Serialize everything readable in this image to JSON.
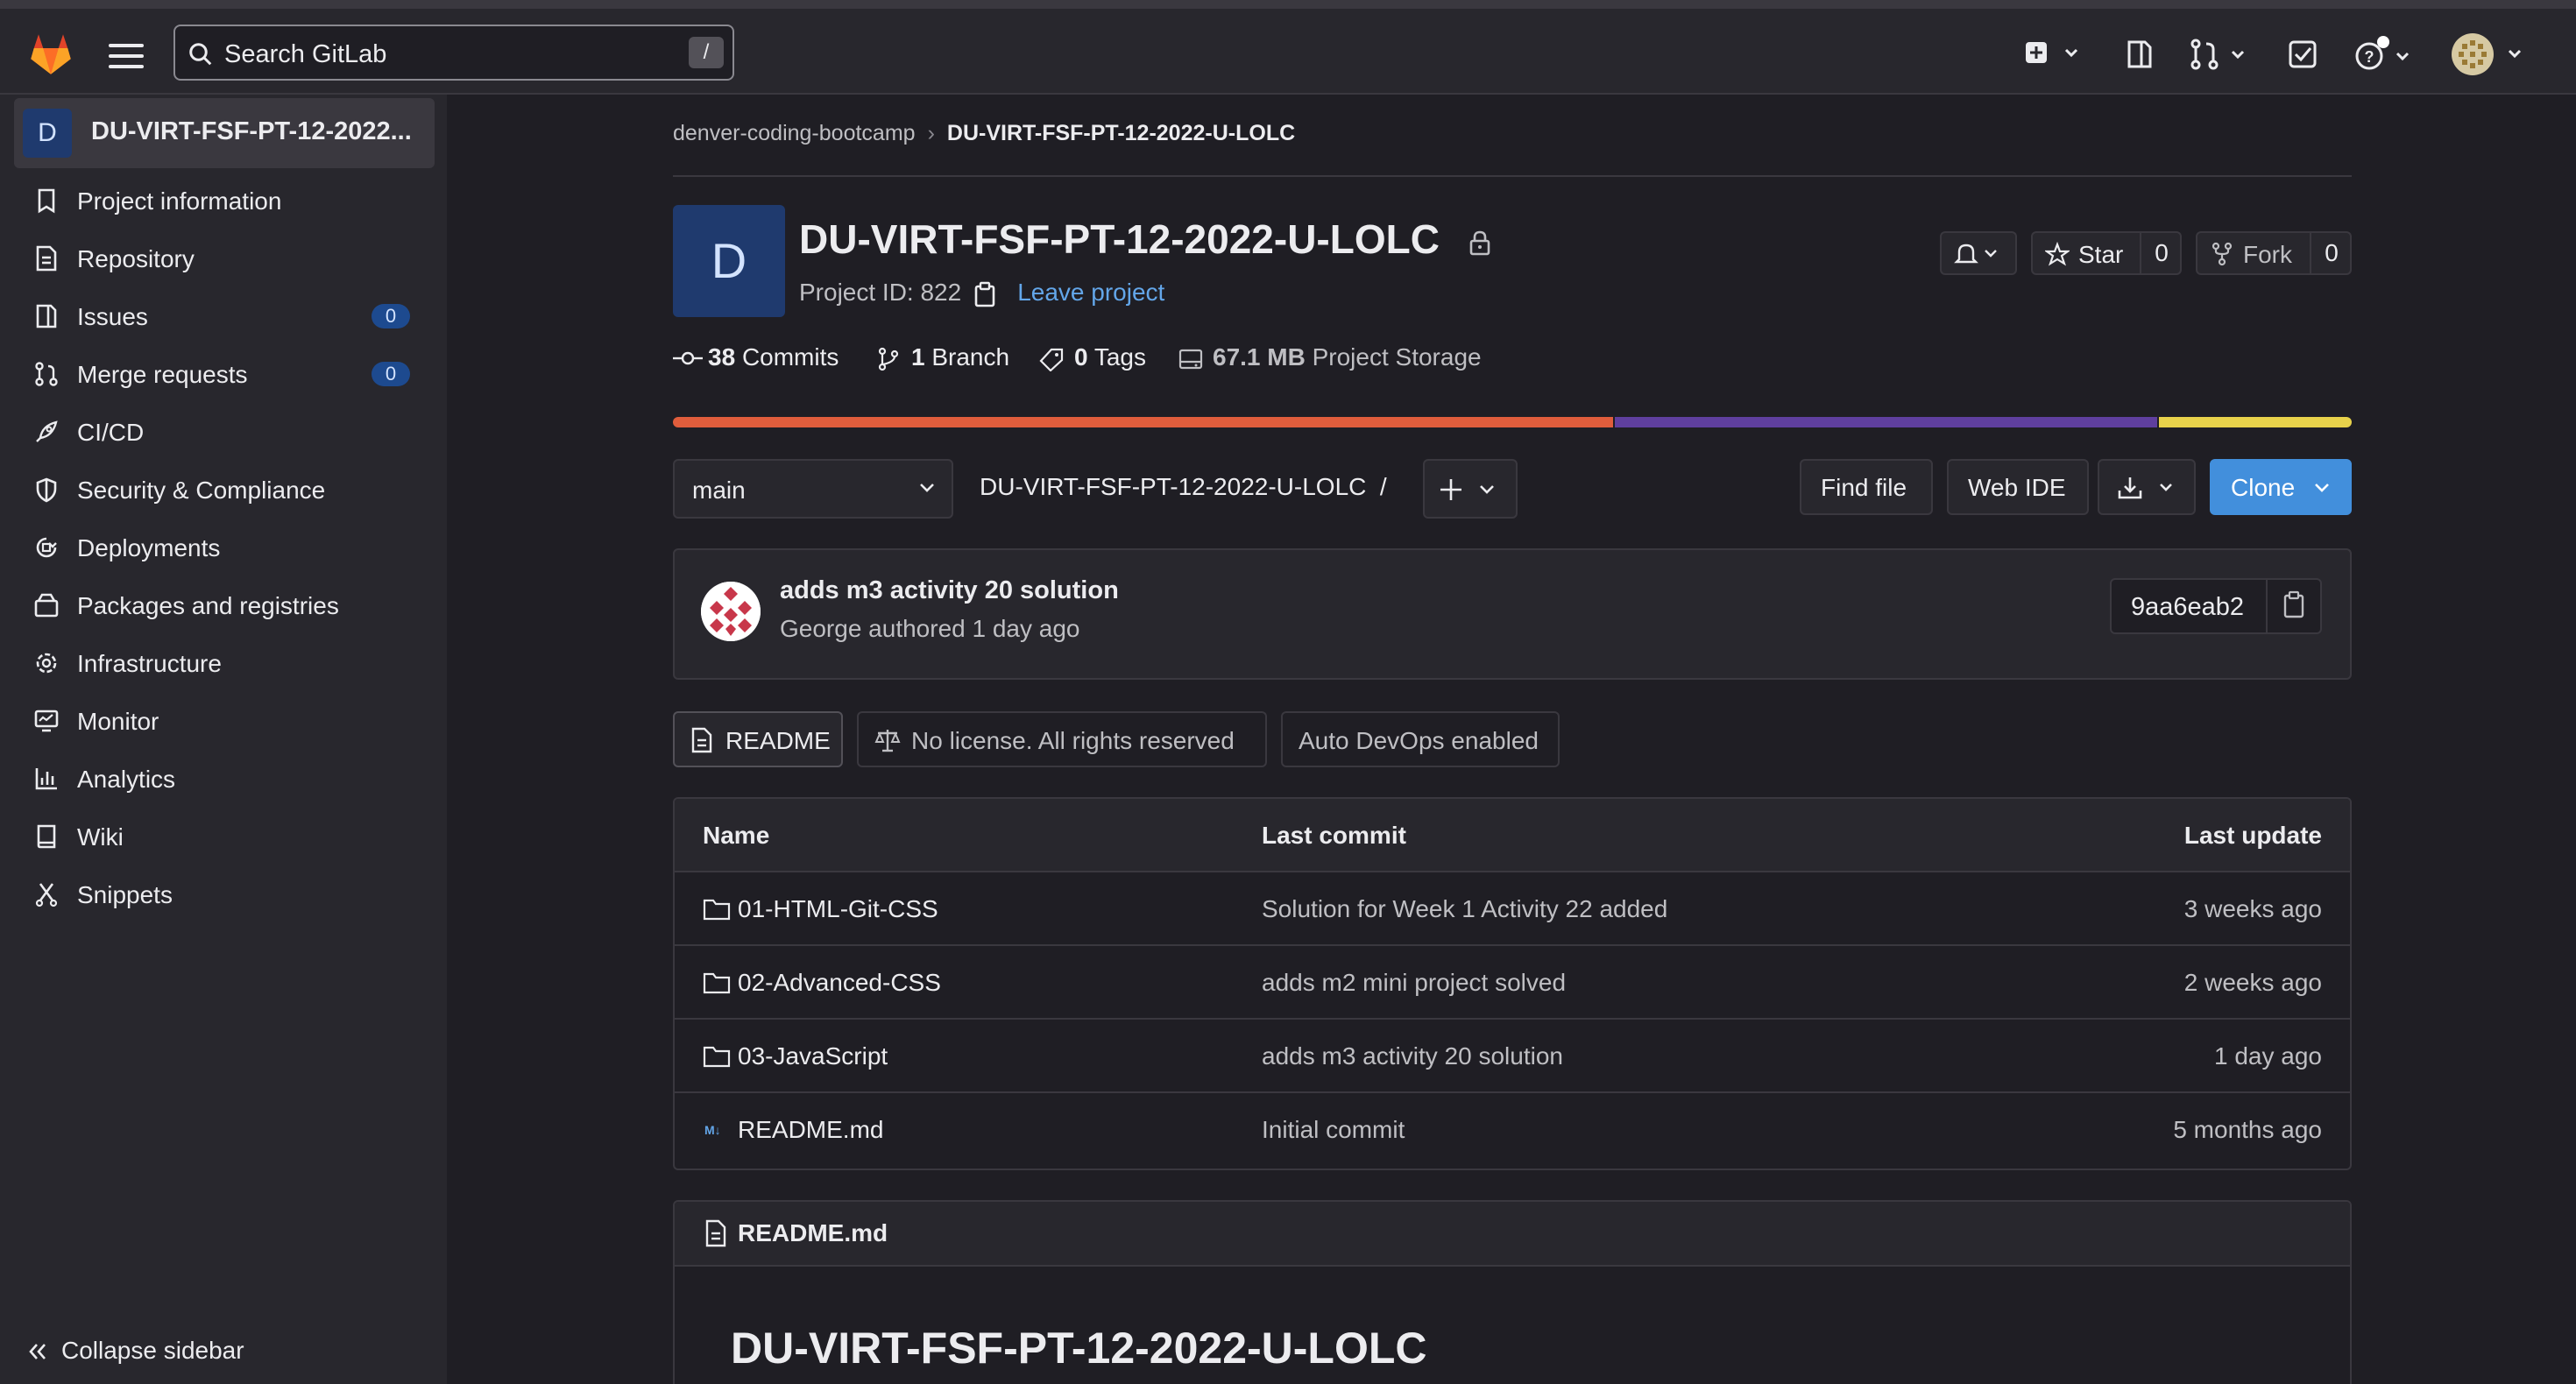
{
  "topbar": {
    "search_placeholder": "Search GitLab",
    "search_shortcut": "/"
  },
  "sidebar": {
    "project_avatar_letter": "D",
    "project_name": "DU-VIRT-FSF-PT-12-2022...",
    "items": [
      {
        "label": "Project information",
        "icon": "info-icon"
      },
      {
        "label": "Repository",
        "icon": "document-icon"
      },
      {
        "label": "Issues",
        "icon": "issues-icon",
        "badge": "0"
      },
      {
        "label": "Merge requests",
        "icon": "merge-request-icon",
        "badge": "0"
      },
      {
        "label": "CI/CD",
        "icon": "rocket-icon"
      },
      {
        "label": "Security & Compliance",
        "icon": "shield-icon"
      },
      {
        "label": "Deployments",
        "icon": "deployments-icon"
      },
      {
        "label": "Packages and registries",
        "icon": "package-icon"
      },
      {
        "label": "Infrastructure",
        "icon": "cloud-gear-icon"
      },
      {
        "label": "Monitor",
        "icon": "monitor-icon"
      },
      {
        "label": "Analytics",
        "icon": "chart-icon"
      },
      {
        "label": "Wiki",
        "icon": "book-icon"
      },
      {
        "label": "Snippets",
        "icon": "snippet-icon"
      }
    ],
    "collapse_label": "Collapse sidebar"
  },
  "breadcrumb": {
    "group": "denver-coding-bootcamp",
    "project": "DU-VIRT-FSF-PT-12-2022-U-LOLC"
  },
  "project": {
    "avatar_letter": "D",
    "title": "DU-VIRT-FSF-PT-12-2022-U-LOLC",
    "id_label": "Project ID: 822",
    "leave_label": "Leave project",
    "star_label": "Star",
    "star_count": "0",
    "fork_label": "Fork",
    "fork_count": "0"
  },
  "stats": {
    "commits_count": "38",
    "commits_label": "Commits",
    "branch_count": "1",
    "branch_label": "Branch",
    "tags_count": "0",
    "tags_label": "Tags",
    "storage_size": "67.1 MB",
    "storage_label": "Project Storage"
  },
  "language_bar": [
    {
      "color": "#e05d3c",
      "fraction": 0.561
    },
    {
      "color": "#5f3f9e",
      "fraction": 0.324
    },
    {
      "color": "#e8d24b",
      "fraction": 0.115
    }
  ],
  "repo": {
    "branch": "main",
    "path": "DU-VIRT-FSF-PT-12-2022-U-LOLC",
    "path_sep": "/",
    "find_file": "Find file",
    "web_ide": "Web IDE",
    "clone": "Clone"
  },
  "last_commit": {
    "title": "adds m3 activity 20 solution",
    "subtitle": "George authored 1 day ago",
    "sha": "9aa6eab2"
  },
  "pills": {
    "readme": "README",
    "license": "No license. All rights reserved",
    "devops": "Auto DevOps enabled"
  },
  "table": {
    "headers": [
      "Name",
      "Last commit",
      "Last update"
    ],
    "rows": [
      {
        "name": "01-HTML-Git-CSS",
        "type": "folder",
        "commit": "Solution for Week 1 Activity 22 added",
        "updated": "3 weeks ago"
      },
      {
        "name": "02-Advanced-CSS",
        "type": "folder",
        "commit": "adds m2 mini project solved",
        "updated": "2 weeks ago"
      },
      {
        "name": "03-JavaScript",
        "type": "folder",
        "commit": "adds m3 activity 20 solution",
        "updated": "1 day ago"
      },
      {
        "name": "README.md",
        "type": "markdown",
        "commit": "Initial commit",
        "updated": "5 months ago"
      }
    ]
  },
  "readme": {
    "file_label": "README.md",
    "heading": "DU-VIRT-FSF-PT-12-2022-U-LOLC"
  },
  "colors": {
    "accent": "#428fdc",
    "link": "#63a6e9",
    "badge_bg": "#1d4a8f"
  }
}
